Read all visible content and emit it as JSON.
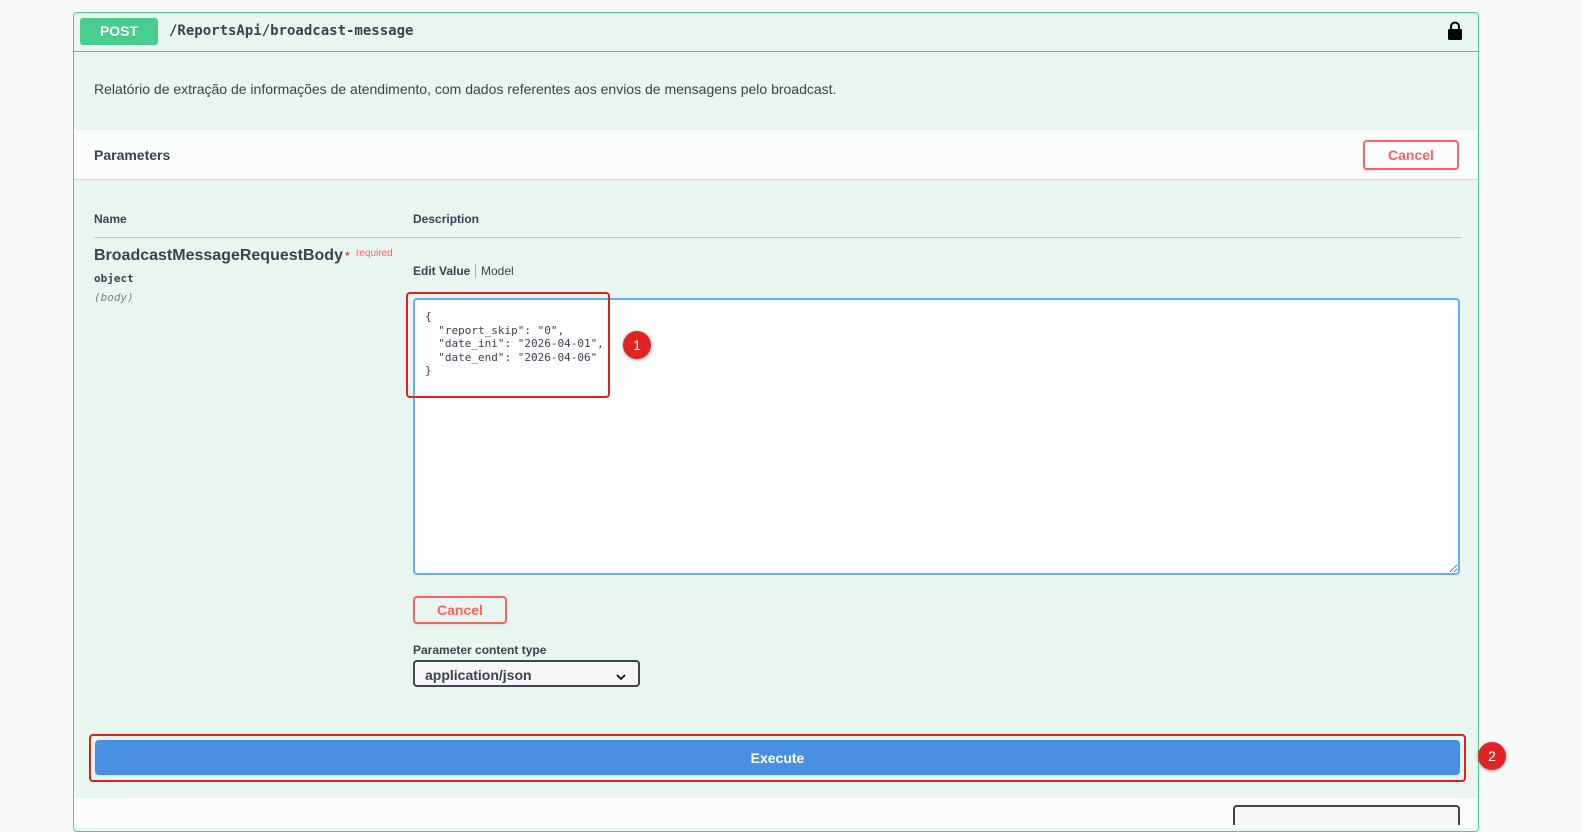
{
  "operation": {
    "method": "POST",
    "path": "/ReportsApi/broadcast-message",
    "lock_icon": "lock-icon",
    "description": "Relatório de extração de informações de atendimento, com dados referentes aos envios de mensagens pelo broadcast."
  },
  "parameters": {
    "title": "Parameters",
    "cancel_label": "Cancel",
    "columns": {
      "name": "Name",
      "description": "Description"
    },
    "body_param": {
      "name": "BroadcastMessageRequestBody",
      "required_star": "*",
      "required_label": "required",
      "type": "object",
      "in": "(body)",
      "tabs": {
        "edit_value": "Edit Value",
        "model": "Model"
      },
      "value": "{\n  \"report_skip\": \"0\",\n  \"date_ini\": \"2026-04-01\",\n  \"date_end\": \"2026-04-06\"\n}"
    },
    "inner_cancel_label": "Cancel",
    "content_type_label": "Parameter content type",
    "content_type_value": "application/json"
  },
  "execute_label": "Execute",
  "annotations": {
    "marker_1": "1",
    "marker_2": "2",
    "highlight_color": "#e02020"
  },
  "colors": {
    "post": "#49cc90",
    "execute": "#4990e2",
    "cancel": "#ff6060",
    "textarea_border": "#61affe"
  }
}
